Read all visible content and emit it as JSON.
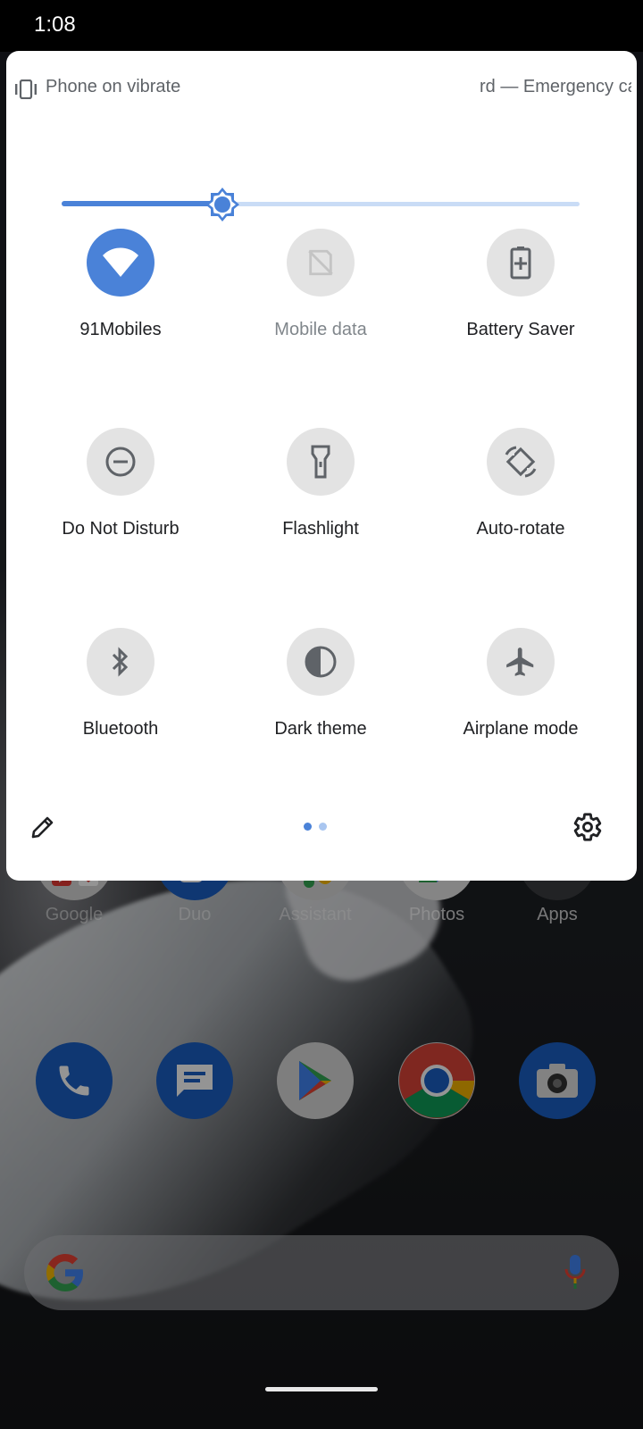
{
  "status_bar": {
    "time": "1:08"
  },
  "quick_settings": {
    "header": {
      "ringer_status": "Phone on vibrate",
      "carrier_text": "rd — Emergency ca"
    },
    "brightness": {
      "level": 0.31
    },
    "tiles": [
      {
        "id": "wifi",
        "label": "91Mobiles",
        "icon": "wifi-icon",
        "active": true
      },
      {
        "id": "mobile-data",
        "label": "Mobile data",
        "icon": "mobile-data-off-icon",
        "active": false,
        "unavailable": true
      },
      {
        "id": "battery-saver",
        "label": "Battery Saver",
        "icon": "battery-saver-icon",
        "active": false
      },
      {
        "id": "dnd",
        "label": "Do Not Disturb",
        "icon": "do-not-disturb-icon",
        "active": false
      },
      {
        "id": "flashlight",
        "label": "Flashlight",
        "icon": "flashlight-icon",
        "active": false
      },
      {
        "id": "auto-rotate",
        "label": "Auto-rotate",
        "icon": "auto-rotate-icon",
        "active": false
      },
      {
        "id": "bluetooth",
        "label": "Bluetooth",
        "icon": "bluetooth-icon",
        "active": false
      },
      {
        "id": "dark-theme",
        "label": "Dark theme",
        "icon": "dark-theme-icon",
        "active": false
      },
      {
        "id": "airplane",
        "label": "Airplane mode",
        "icon": "airplane-icon",
        "active": false
      }
    ],
    "footer": {
      "page_count": 2,
      "current_page": 1
    }
  },
  "home_screen": {
    "app_labels": [
      "Google",
      "Duo",
      "Assistant",
      "Photos",
      "Apps"
    ],
    "dock_icons": [
      "phone-icon",
      "messages-icon",
      "play-store-icon",
      "chrome-icon",
      "camera-icon"
    ]
  },
  "colors": {
    "accent": "#4a82d8",
    "tile_inactive": "#e3e3e3",
    "panel_bg": "#ffffff"
  }
}
